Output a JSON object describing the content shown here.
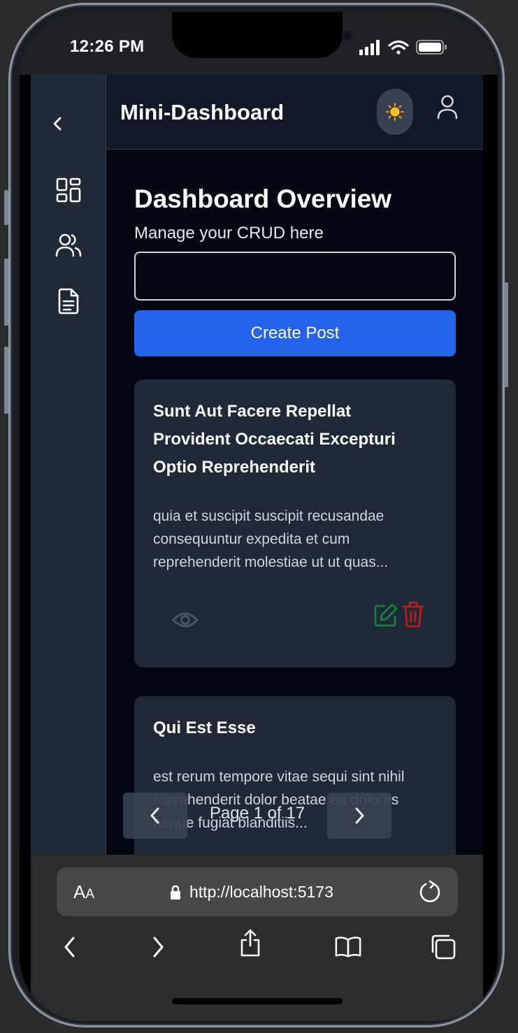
{
  "status": {
    "time": "12:26 PM"
  },
  "app": {
    "brand": "Mini-Dashboard",
    "page_title": "Dashboard Overview",
    "page_subtitle": "Manage your CRUD here",
    "post_input": {
      "value": "",
      "placeholder": ""
    },
    "create_button": "Create Post",
    "sidebar_items": [
      {
        "name": "collapse-sidebar",
        "icon": "chevron-left-icon"
      },
      {
        "name": "dashboard",
        "icon": "dashboard-grid-icon"
      },
      {
        "name": "users",
        "icon": "users-icon"
      },
      {
        "name": "posts",
        "icon": "document-icon"
      }
    ],
    "posts": [
      {
        "title": "Sunt Aut Facere Repellat Provident Occaecati Excepturi Optio Reprehenderit",
        "body": "quia et suscipit suscipit recusandae consequuntur expedita et cum reprehenderit molestiae ut ut quas..."
      },
      {
        "title": "Qui Est Esse",
        "body": "est rerum tempore vitae sequi sint nihil reprehenderit dolor beatae ea dolores neque fugiat blanditiis..."
      }
    ],
    "pagination": {
      "label": "Page 1 of 17"
    }
  },
  "browser": {
    "text_size_label_big": "A",
    "text_size_label_small": "A",
    "url": "http://localhost:5173"
  },
  "colors": {
    "primary": "#2563eb",
    "edit": "#15803d",
    "delete": "#b91c1c",
    "view": "#4b5563"
  }
}
